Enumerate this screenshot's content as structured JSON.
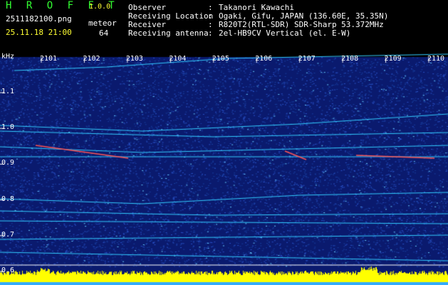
{
  "header": {
    "app_name": "H R O F F T",
    "app_version": "1.0.0",
    "file_name": "2511182100.png",
    "datetime": "25.11.18 21:00",
    "meteor_label": "meteor",
    "meteor_count": "64",
    "info": [
      {
        "label": "Observer",
        "value": "Takanori Kawachi"
      },
      {
        "label": "Receiving Location",
        "value": "Ogaki, Gifu, JAPAN (136.60E, 35.35N)"
      },
      {
        "label": "Receiver",
        "value": "R820T2(RTL-SDR) SDR-Sharp 53.372MHz"
      },
      {
        "label": "Receiving antenna",
        "value": "2el-HB9CV Vertical (el. E-W)"
      }
    ],
    "colon": ":"
  },
  "plot": {
    "unit": "kHz",
    "time_ticks": [
      "2101",
      "2102",
      "2103",
      "2104",
      "2105",
      "2106",
      "2107",
      "2108",
      "2109",
      "2110"
    ],
    "freq_ticks": [
      "1.1",
      "1.0",
      "0.9",
      "0.8",
      "0.7",
      "0.6"
    ],
    "colors": {
      "background": "#0a1a6e",
      "noise": "#2a52c8",
      "trace": "#33ccff",
      "meteor": "#ff5555",
      "level": "#ffff00",
      "level_base": "#33aaff"
    }
  }
}
